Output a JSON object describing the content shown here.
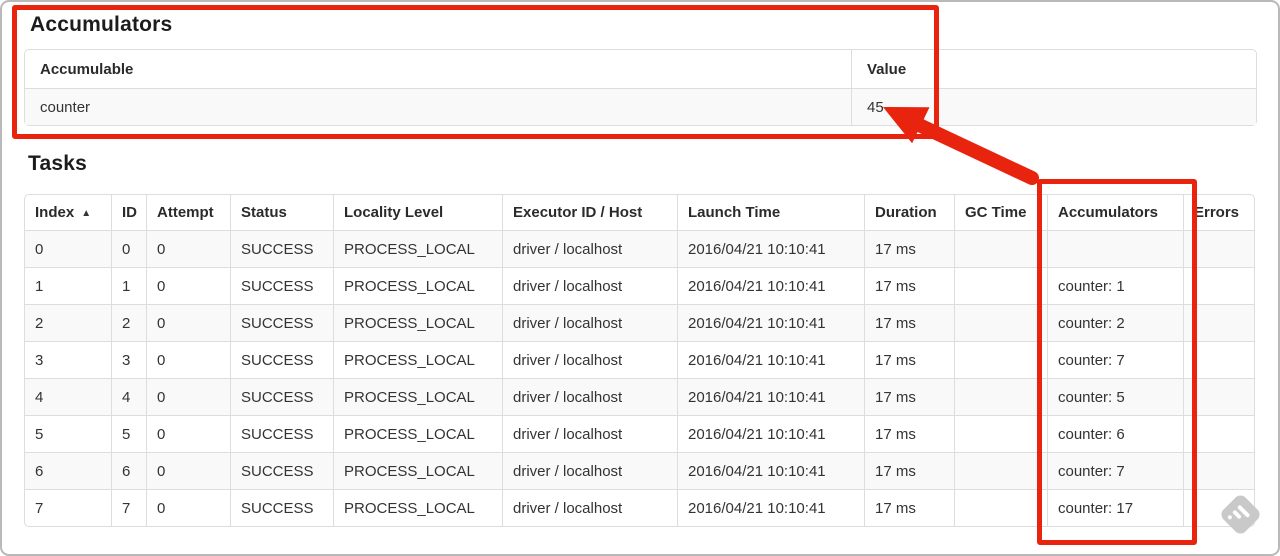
{
  "colors": {
    "annotation_red": "#e8230e",
    "row_stripe": "#f9f9f9",
    "table_border": "#dddddd",
    "watermark_gray": "#c9c9c9"
  },
  "accumulators": {
    "title": "Accumulators",
    "table": {
      "headers": [
        "Accumulable",
        "Value"
      ],
      "rows": [
        {
          "accumulable": "counter",
          "value": "45"
        }
      ]
    }
  },
  "tasks": {
    "title": "Tasks",
    "table": {
      "headers": [
        "Index",
        "ID",
        "Attempt",
        "Status",
        "Locality Level",
        "Executor ID / Host",
        "Launch Time",
        "Duration",
        "GC Time",
        "Accumulators",
        "Errors"
      ],
      "sort": {
        "column": "Index",
        "direction": "ascending",
        "icon": "▲"
      },
      "rows": [
        {
          "index": "0",
          "id": "0",
          "attempt": "0",
          "status": "SUCCESS",
          "locality_level": "PROCESS_LOCAL",
          "executor_id_host": "driver / localhost",
          "launch_time": "2016/04/21 10:10:41",
          "duration": "17 ms",
          "gc_time": "",
          "accumulators": "",
          "errors": ""
        },
        {
          "index": "1",
          "id": "1",
          "attempt": "0",
          "status": "SUCCESS",
          "locality_level": "PROCESS_LOCAL",
          "executor_id_host": "driver / localhost",
          "launch_time": "2016/04/21 10:10:41",
          "duration": "17 ms",
          "gc_time": "",
          "accumulators": "counter: 1",
          "errors": ""
        },
        {
          "index": "2",
          "id": "2",
          "attempt": "0",
          "status": "SUCCESS",
          "locality_level": "PROCESS_LOCAL",
          "executor_id_host": "driver / localhost",
          "launch_time": "2016/04/21 10:10:41",
          "duration": "17 ms",
          "gc_time": "",
          "accumulators": "counter: 2",
          "errors": ""
        },
        {
          "index": "3",
          "id": "3",
          "attempt": "0",
          "status": "SUCCESS",
          "locality_level": "PROCESS_LOCAL",
          "executor_id_host": "driver / localhost",
          "launch_time": "2016/04/21 10:10:41",
          "duration": "17 ms",
          "gc_time": "",
          "accumulators": "counter: 7",
          "errors": ""
        },
        {
          "index": "4",
          "id": "4",
          "attempt": "0",
          "status": "SUCCESS",
          "locality_level": "PROCESS_LOCAL",
          "executor_id_host": "driver / localhost",
          "launch_time": "2016/04/21 10:10:41",
          "duration": "17 ms",
          "gc_time": "",
          "accumulators": "counter: 5",
          "errors": ""
        },
        {
          "index": "5",
          "id": "5",
          "attempt": "0",
          "status": "SUCCESS",
          "locality_level": "PROCESS_LOCAL",
          "executor_id_host": "driver / localhost",
          "launch_time": "2016/04/21 10:10:41",
          "duration": "17 ms",
          "gc_time": "",
          "accumulators": "counter: 6",
          "errors": ""
        },
        {
          "index": "6",
          "id": "6",
          "attempt": "0",
          "status": "SUCCESS",
          "locality_level": "PROCESS_LOCAL",
          "executor_id_host": "driver / localhost",
          "launch_time": "2016/04/21 10:10:41",
          "duration": "17 ms",
          "gc_time": "",
          "accumulators": "counter: 7",
          "errors": ""
        },
        {
          "index": "7",
          "id": "7",
          "attempt": "0",
          "status": "SUCCESS",
          "locality_level": "PROCESS_LOCAL",
          "executor_id_host": "driver / localhost",
          "launch_time": "2016/04/21 10:10:41",
          "duration": "17 ms",
          "gc_time": "",
          "accumulators": "counter: 17",
          "errors": ""
        }
      ]
    }
  },
  "annotation": {
    "color": "#e8230e",
    "highlighted_value": "45",
    "boxes": [
      "accumulators-section",
      "tasks-accumulators-column"
    ]
  },
  "watermark": {
    "icon": "skitch-stamp-icon"
  }
}
